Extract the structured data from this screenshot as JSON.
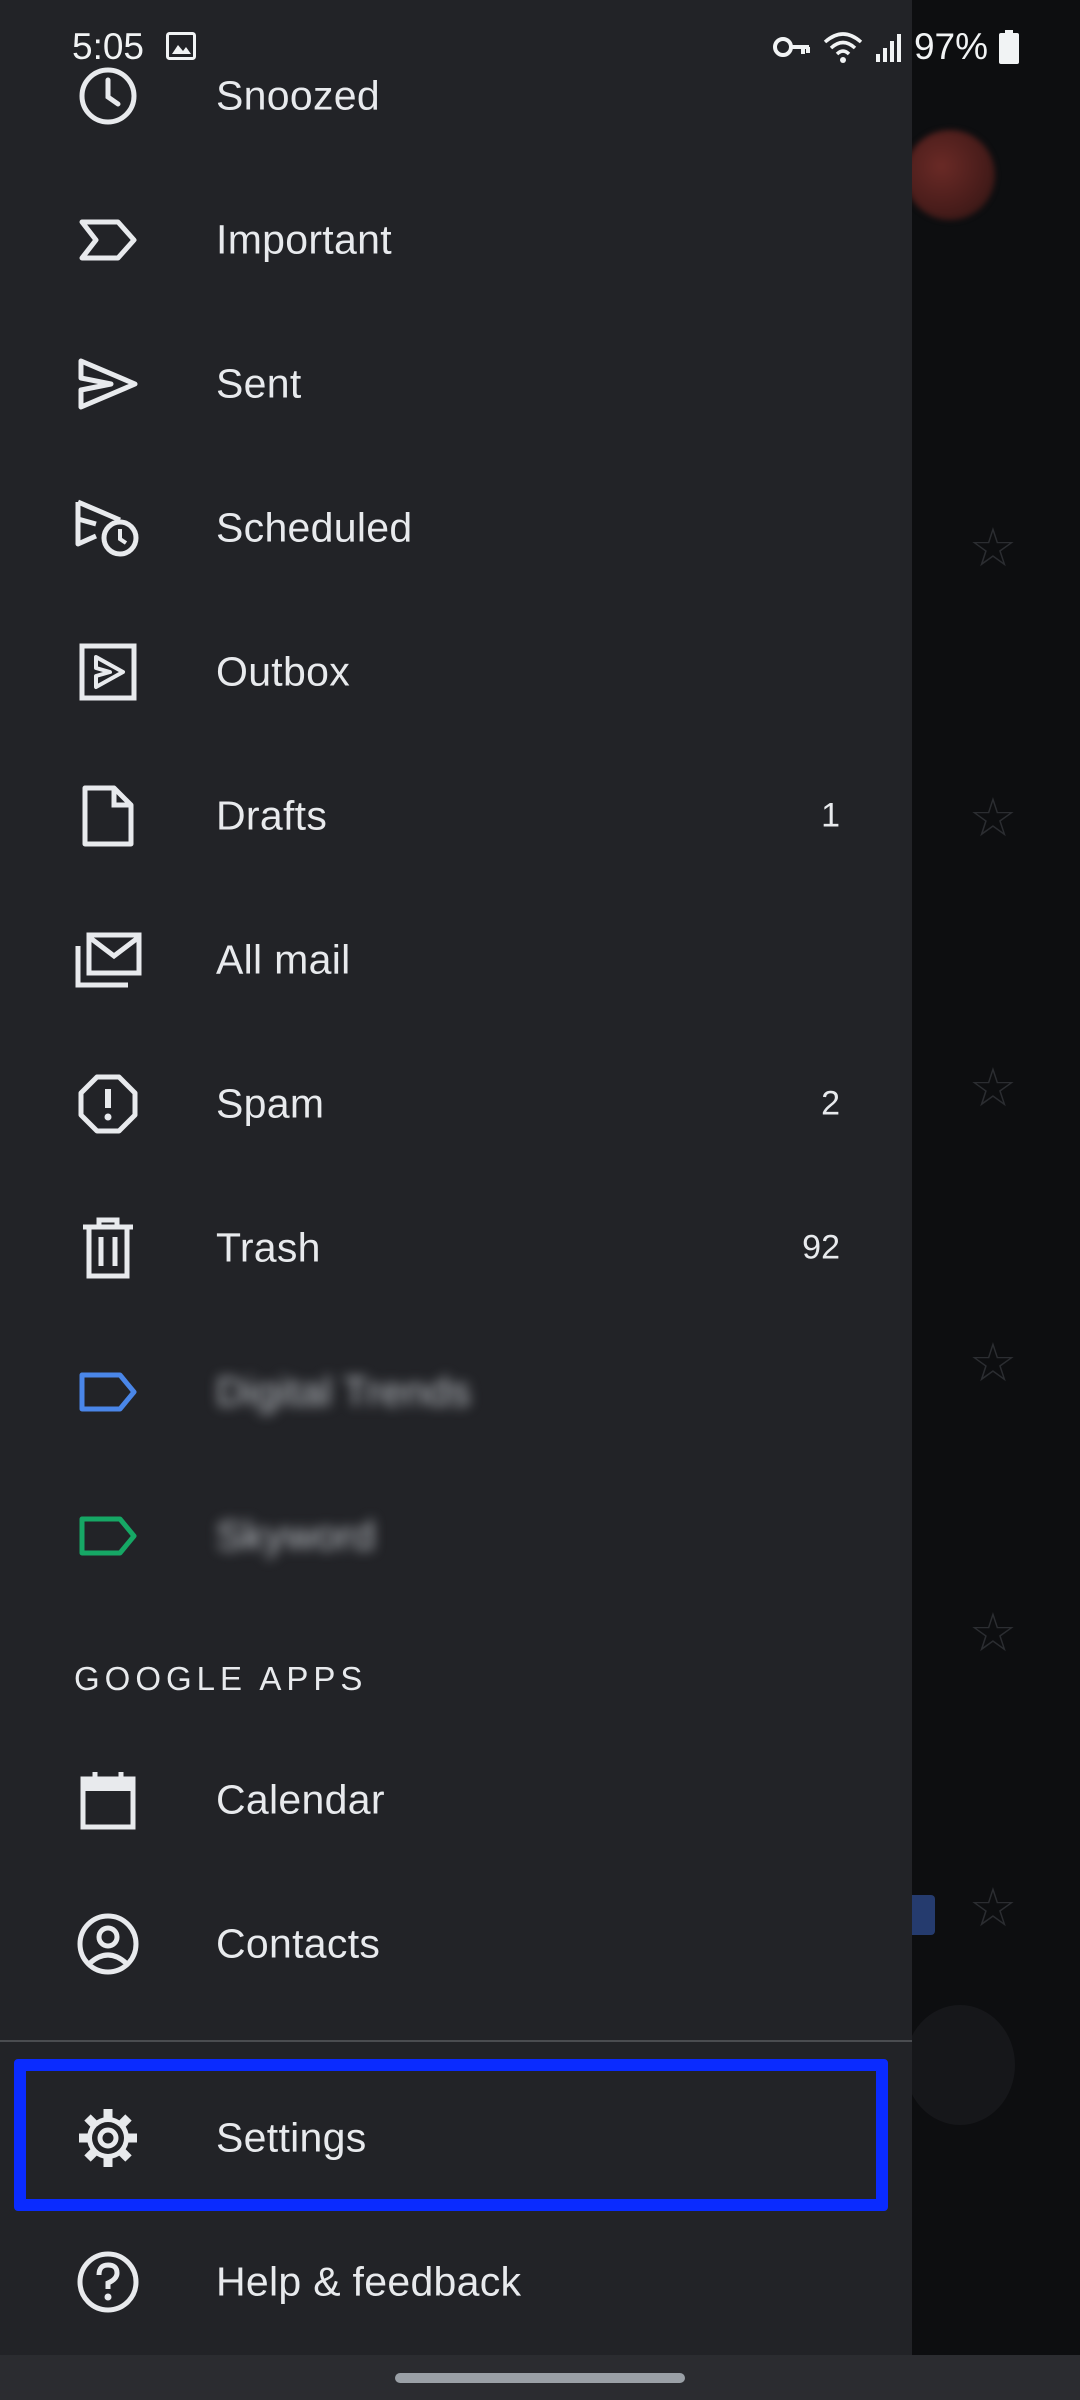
{
  "status_bar": {
    "time": "5:05",
    "battery": "97%"
  },
  "drawer": {
    "items": [
      {
        "label": "Snoozed",
        "icon": "clock-icon",
        "count": ""
      },
      {
        "label": "Important",
        "icon": "important-icon",
        "count": ""
      },
      {
        "label": "Sent",
        "icon": "send-icon",
        "count": ""
      },
      {
        "label": "Scheduled",
        "icon": "scheduled-send-icon",
        "count": ""
      },
      {
        "label": "Outbox",
        "icon": "outbox-icon",
        "count": ""
      },
      {
        "label": "Drafts",
        "icon": "draft-file-icon",
        "count": "1"
      },
      {
        "label": "All mail",
        "icon": "all-mail-icon",
        "count": ""
      },
      {
        "label": "Spam",
        "icon": "spam-icon",
        "count": "2"
      },
      {
        "label": "Trash",
        "icon": "trash-icon",
        "count": "92"
      },
      {
        "label": "Digital Trends",
        "icon": "label-icon",
        "color": "#4a86e8",
        "count": ""
      },
      {
        "label": "Skyword",
        "icon": "label-icon",
        "color": "#16a765",
        "count": ""
      }
    ],
    "section_header": "GOOGLE APPS",
    "apps": [
      {
        "label": "Calendar",
        "icon": "calendar-icon"
      },
      {
        "label": "Contacts",
        "icon": "contacts-icon"
      }
    ],
    "bottom": [
      {
        "label": "Settings",
        "icon": "gear-icon"
      },
      {
        "label": "Help & feedback",
        "icon": "help-icon"
      }
    ]
  },
  "colors": {
    "drawer_bg": "#222327",
    "highlight": "#0a2bff",
    "label_blue": "#4a86e8",
    "label_green": "#16a765"
  }
}
